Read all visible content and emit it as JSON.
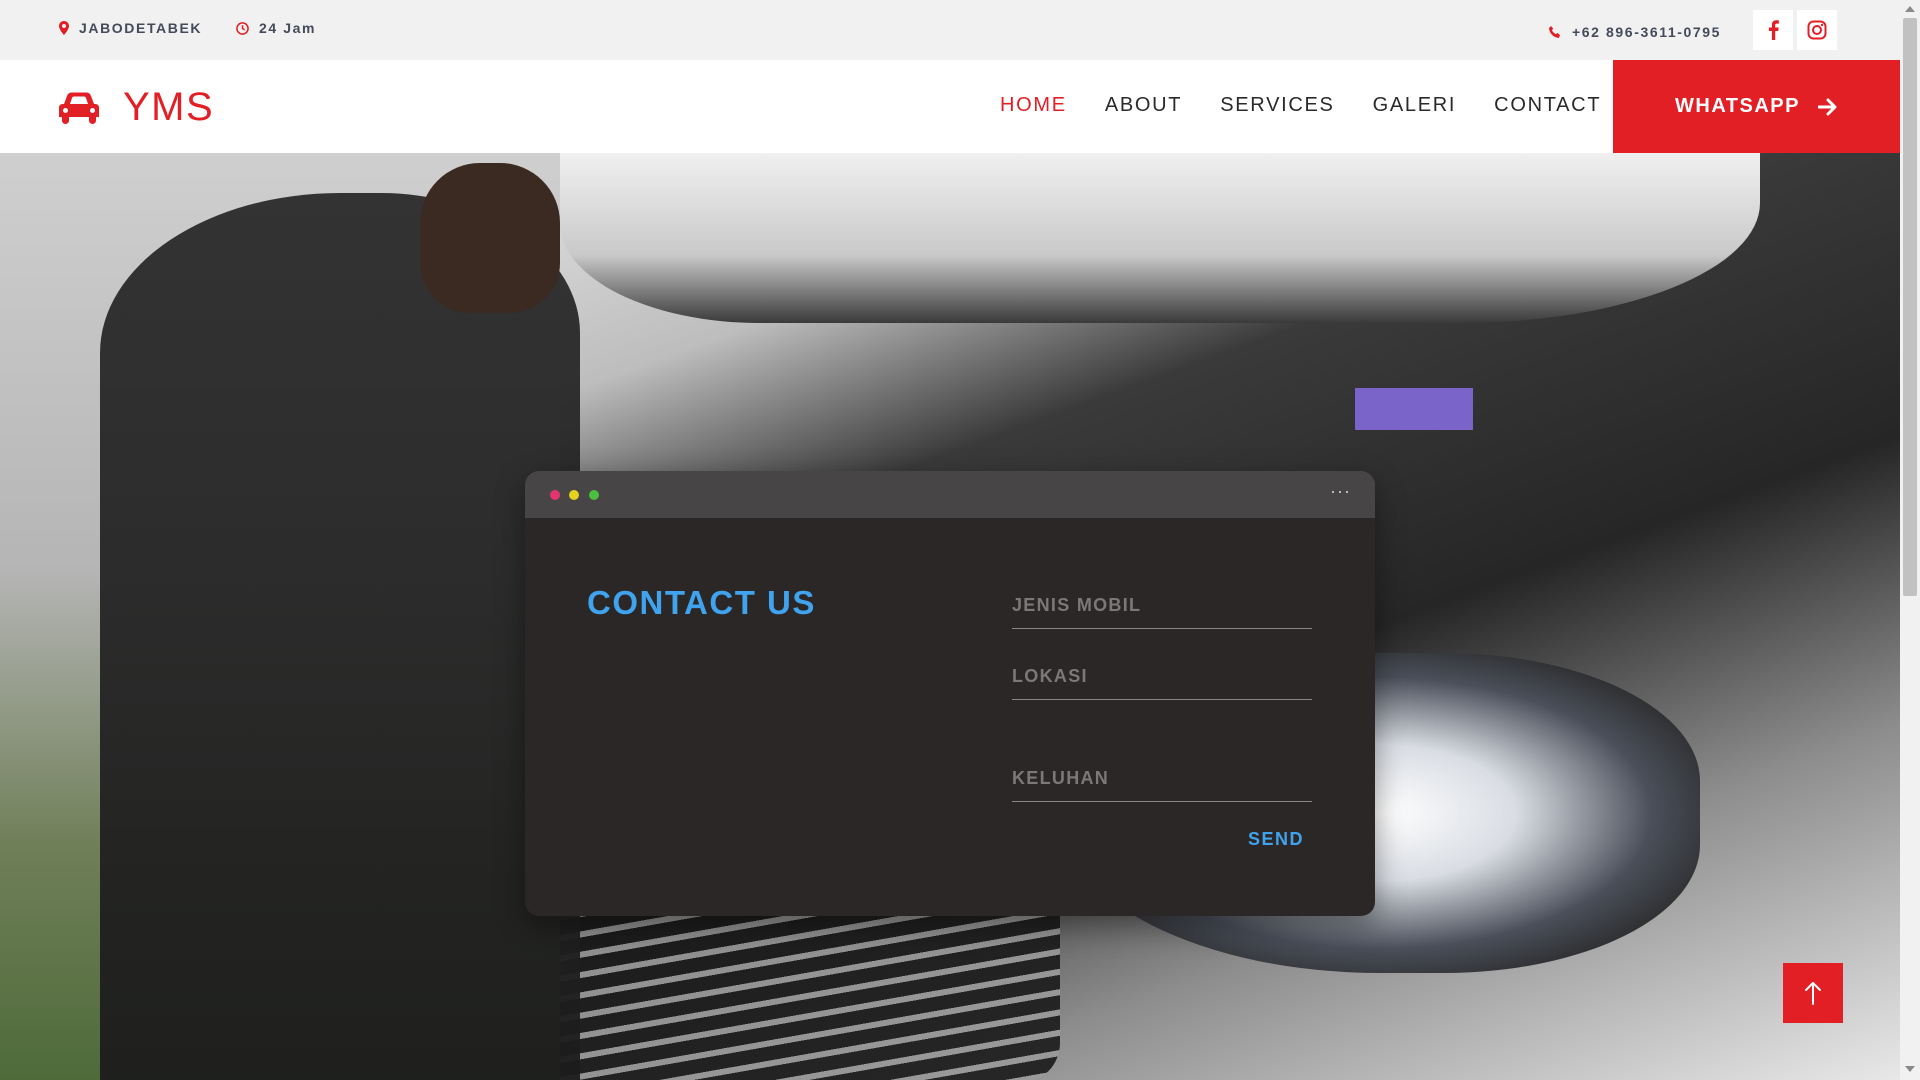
{
  "topbar": {
    "location": "JABODETABEK",
    "hours": "24 Jam",
    "phone": "+62 896-3611-0795",
    "social": [
      {
        "icon": "facebook-icon"
      },
      {
        "icon": "instagram-icon"
      }
    ]
  },
  "navbar": {
    "brand_icon": "car-icon",
    "brand_name": "YMS",
    "links": [
      {
        "label": "HOME",
        "active": true
      },
      {
        "label": "ABOUT",
        "active": false
      },
      {
        "label": "SERVICES",
        "active": false
      },
      {
        "label": "GALERI",
        "active": false
      },
      {
        "label": "CONTACT",
        "active": false
      }
    ],
    "whatsapp_label": "WHATSAPP",
    "whatsapp_icon": "arrow-right-icon"
  },
  "contact_card": {
    "title": "CONTACT US",
    "window_dots": [
      "#e2356f",
      "#e4d21f",
      "#4bbf3f"
    ],
    "menu_icon": "ellipsis-icon",
    "fields": {
      "jenis_mobil_placeholder": "JENIS MOBIL",
      "lokasi_placeholder": "LOKASI",
      "keluhan_placeholder": "KELUHAN"
    },
    "send_label": "SEND"
  },
  "scroll_top_icon": "arrow-up-icon",
  "colors": {
    "brand_red": "#e31f26",
    "accent_blue": "#3fa3ee",
    "card_bg": "#2c2727"
  }
}
